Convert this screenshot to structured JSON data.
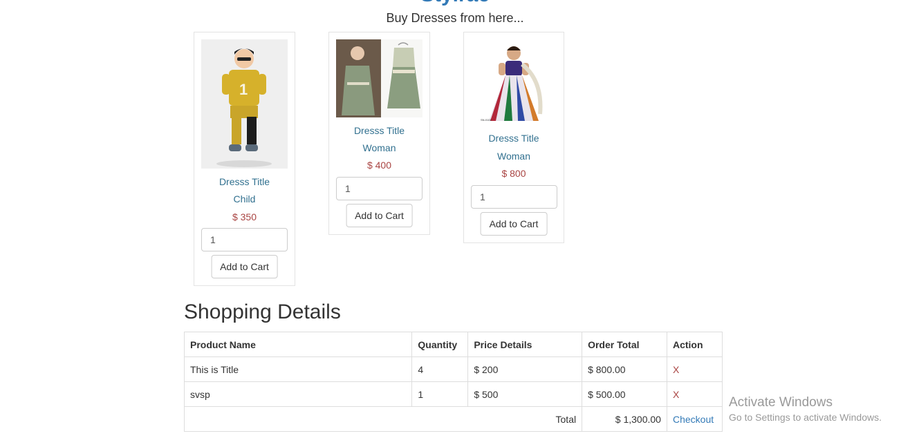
{
  "header": {
    "site_title": "Stylrac",
    "subtitle": "Buy Dresses from here..."
  },
  "products": [
    {
      "title": "Dresss Title",
      "category": "Child",
      "price": "$ 350",
      "quantity": "1",
      "button": "Add to Cart"
    },
    {
      "title": "Dresss Title",
      "category": "Woman",
      "price": "$ 400",
      "quantity": "1",
      "button": "Add to Cart"
    },
    {
      "title": "Dresss Title",
      "category": "Woman",
      "price": "$ 800",
      "quantity": "1",
      "button": "Add to Cart"
    }
  ],
  "cart": {
    "heading": "Shopping Details",
    "columns": [
      "Product Name",
      "Quantity",
      "Price Details",
      "Order Total",
      "Action"
    ],
    "rows": [
      {
        "name": "This is Title",
        "quantity": "4",
        "price": "$ 200",
        "total": "$ 800.00",
        "action": "X"
      },
      {
        "name": "svsp",
        "quantity": "1",
        "price": "$ 500",
        "total": "$ 500.00",
        "action": "X"
      }
    ],
    "total_label": "Total",
    "total_value": "$ 1,300.00",
    "checkout": "Checkout"
  },
  "watermark": {
    "line1": "Activate Windows",
    "line2": "Go to Settings to activate Windows."
  },
  "colors": {
    "link": "#337ab7",
    "muted_link": "#31708f",
    "price": "#a94442"
  }
}
